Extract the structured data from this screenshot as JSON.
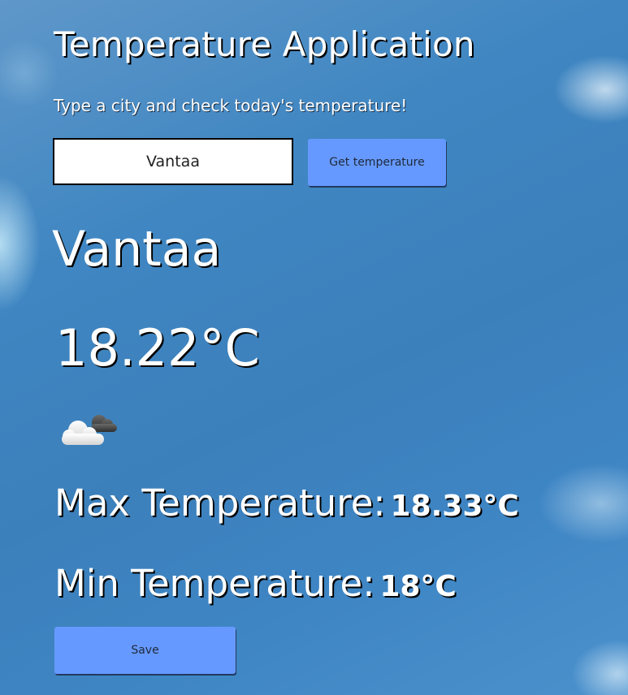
{
  "header": {
    "title": "Temperature Application",
    "subtitle": "Type a city and check today's temperature!"
  },
  "search": {
    "value": "Vantaa",
    "button_label": "Get temperature"
  },
  "weather": {
    "city": "Vantaa",
    "temperature": "18.22°C",
    "icon": "cloudy-icon",
    "max_label": "Max Temperature:",
    "max_value": "18.33°C",
    "min_label": "Min Temperature:",
    "min_value": "18°C"
  },
  "actions": {
    "save_label": "Save"
  },
  "colors": {
    "button": "#6699ff",
    "text": "#ffffff",
    "text_shadow": "#000000"
  }
}
